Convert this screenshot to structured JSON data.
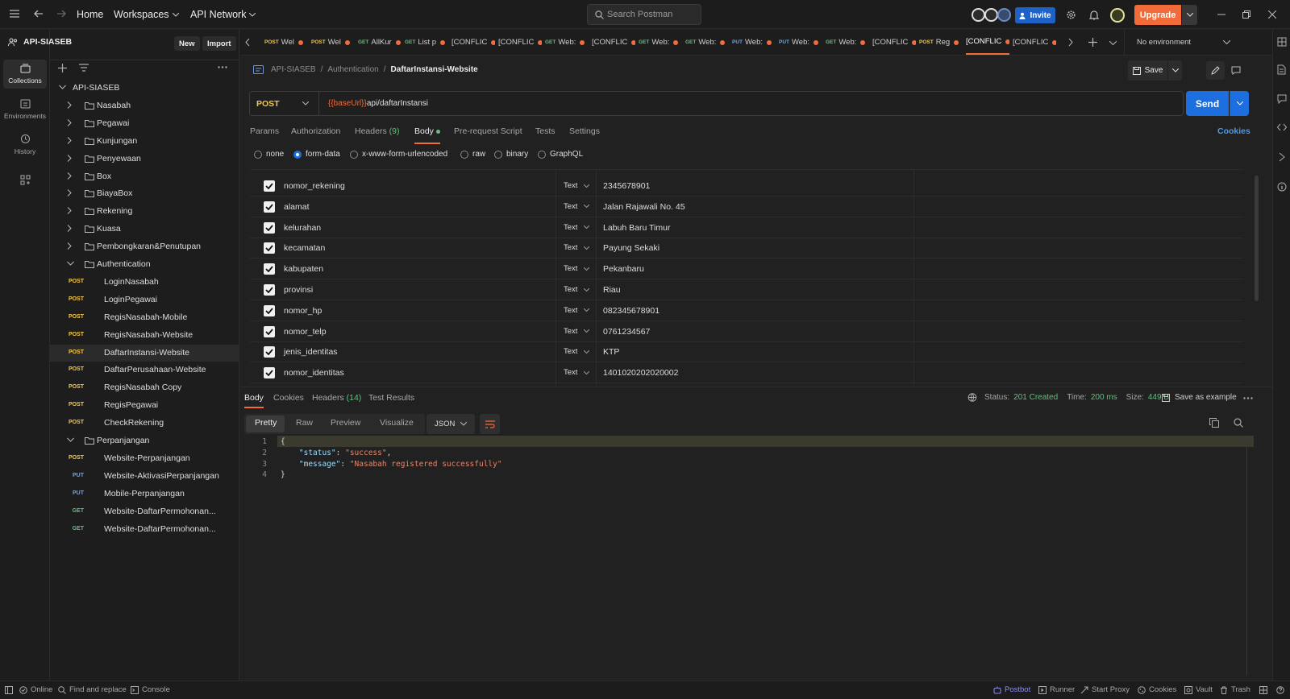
{
  "topbar": {
    "nav": [
      "Home",
      "Workspaces",
      "API Network"
    ],
    "search_placeholder": "Search Postman",
    "invite": "Invite",
    "upgrade": "Upgrade"
  },
  "rail": [
    "Collections",
    "Environments",
    "History"
  ],
  "sidebar": {
    "workspace": "API-SIASEB",
    "new_label": "New",
    "import_label": "Import",
    "collection": "API-SIASEB",
    "folders": [
      "Nasabah",
      "Pegawai",
      "Kunjungan",
      "Penyewaan",
      "Box",
      "BiayaBox",
      "Rekening",
      "Kuasa",
      "Pembongkaran&Penutupan",
      "Authentication"
    ],
    "auth_items": [
      {
        "method": "POST",
        "name": "LoginNasabah"
      },
      {
        "method": "POST",
        "name": "LoginPegawai"
      },
      {
        "method": "POST",
        "name": "RegisNasabah-Mobile"
      },
      {
        "method": "POST",
        "name": "RegisNasabah-Website"
      },
      {
        "method": "POST",
        "name": "DaftarInstansi-Website"
      },
      {
        "method": "POST",
        "name": "DaftarPerusahaan-Website"
      },
      {
        "method": "POST",
        "name": "RegisNasabah Copy"
      },
      {
        "method": "POST",
        "name": "RegisPegawai"
      },
      {
        "method": "POST",
        "name": "CheckRekening"
      }
    ],
    "folder_perpanjangan": "Perpanjangan",
    "perpanjangan_items": [
      {
        "method": "POST",
        "name": "Website-Perpanjangan"
      },
      {
        "method": "PUT",
        "name": "Website-AktivasiPerpanjangan"
      },
      {
        "method": "PUT",
        "name": "Mobile-Perpanjangan"
      },
      {
        "method": "GET",
        "name": "Website-DaftarPermohonan..."
      },
      {
        "method": "GET",
        "name": "Website-DaftarPermohonan..."
      }
    ]
  },
  "tabs": [
    {
      "method": "POST",
      "name": "Wel"
    },
    {
      "method": "POST",
      "name": "Wel"
    },
    {
      "method": "GET",
      "name": "AllKur"
    },
    {
      "method": "GET",
      "name": "List p"
    },
    {
      "method": "",
      "name": "[CONFLIC"
    },
    {
      "method": "",
      "name": "[CONFLIC"
    },
    {
      "method": "GET",
      "name": "Web:"
    },
    {
      "method": "",
      "name": "[CONFLIC"
    },
    {
      "method": "GET",
      "name": "Web:"
    },
    {
      "method": "GET",
      "name": "Web:"
    },
    {
      "method": "PUT",
      "name": "Web:"
    },
    {
      "method": "PUT",
      "name": "Web:"
    },
    {
      "method": "GET",
      "name": "Web:"
    },
    {
      "method": "",
      "name": "[CONFLIC"
    },
    {
      "method": "POST",
      "name": "Reg"
    },
    {
      "method": "",
      "name": "[CONFLIC"
    },
    {
      "method": "",
      "name": "[CONFLIC"
    }
  ],
  "environment": "No environment",
  "request": {
    "breadcrumb": [
      "API-SIASEB",
      "Authentication",
      "DaftarInstansi-Website"
    ],
    "save": "Save",
    "method": "POST",
    "url_var": "{{baseUrl}}",
    "url_path": "api/daftarInstansi",
    "send": "Send",
    "tabs": [
      "Params",
      "Authorization",
      "Headers",
      "Body",
      "Pre-request Script",
      "Tests",
      "Settings"
    ],
    "headers_count": "(9)",
    "cookies": "Cookies",
    "body_types": [
      "none",
      "form-data",
      "x-www-form-urlencoded",
      "raw",
      "binary",
      "GraphQL"
    ],
    "params": [
      {
        "key": "nomor_rekening",
        "type": "Text",
        "value": "2345678901"
      },
      {
        "key": "alamat",
        "type": "Text",
        "value": "Jalan Rajawali No. 45"
      },
      {
        "key": "kelurahan",
        "type": "Text",
        "value": "Labuh Baru Timur"
      },
      {
        "key": "kecamatan",
        "type": "Text",
        "value": "Payung Sekaki"
      },
      {
        "key": "kabupaten",
        "type": "Text",
        "value": "Pekanbaru"
      },
      {
        "key": "provinsi",
        "type": "Text",
        "value": "Riau"
      },
      {
        "key": "nomor_hp",
        "type": "Text",
        "value": "082345678901"
      },
      {
        "key": "nomor_telp",
        "type": "Text",
        "value": "0761234567"
      },
      {
        "key": "jenis_identitas",
        "type": "Text",
        "value": "KTP"
      },
      {
        "key": "nomor_identitas",
        "type": "Text",
        "value": "1401020202020002"
      }
    ]
  },
  "response": {
    "tabs": [
      "Body",
      "Cookies",
      "Headers",
      "Test Results"
    ],
    "headers_count": "(14)",
    "status_label": "Status:",
    "status": "201 Created",
    "time_label": "Time:",
    "time": "200 ms",
    "size_label": "Size:",
    "size": "449 B",
    "save_example": "Save as example",
    "formats": [
      "Pretty",
      "Raw",
      "Preview",
      "Visualize"
    ],
    "lang": "JSON",
    "lines": [
      {
        "n": "1",
        "text": "{"
      },
      {
        "n": "2",
        "key": "\"status\"",
        "val": "\"success\"",
        "comma": ","
      },
      {
        "n": "3",
        "key": "\"message\"",
        "val": "\"Nasabah registered successfully\"",
        "comma": ""
      },
      {
        "n": "4",
        "text": "}"
      }
    ]
  },
  "statusbar": {
    "left": [
      "Online",
      "Find and replace",
      "Console"
    ],
    "right": [
      "Postbot",
      "Runner",
      "Start Proxy",
      "Cookies",
      "Vault",
      "Trash"
    ]
  },
  "colors": {
    "accent": "#f26b3a",
    "send": "#1d6fe0",
    "post": "#f2c94c",
    "get": "#5ec27b",
    "put": "#6aa5f0",
    "ok": "#5ec27b"
  }
}
